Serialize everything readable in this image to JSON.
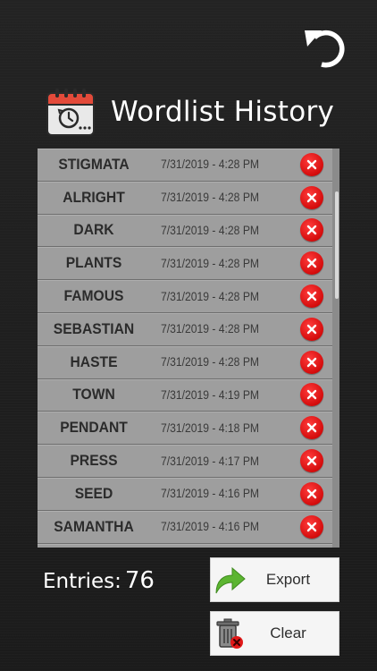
{
  "header": {
    "title": "Wordlist History"
  },
  "history": {
    "rows": [
      {
        "word": "STIGMATA",
        "date": "7/31/2019 - 4:28 PM"
      },
      {
        "word": "ALRIGHT",
        "date": "7/31/2019 - 4:28 PM"
      },
      {
        "word": "DARK",
        "date": "7/31/2019 - 4:28 PM"
      },
      {
        "word": "PLANTS",
        "date": "7/31/2019 - 4:28 PM"
      },
      {
        "word": "FAMOUS",
        "date": "7/31/2019 - 4:28 PM"
      },
      {
        "word": "SEBASTIAN",
        "date": "7/31/2019 - 4:28 PM"
      },
      {
        "word": "HASTE",
        "date": "7/31/2019 - 4:28 PM"
      },
      {
        "word": "TOWN",
        "date": "7/31/2019 - 4:19 PM"
      },
      {
        "word": "PENDANT",
        "date": "7/31/2019 - 4:18 PM"
      },
      {
        "word": "PRESS",
        "date": "7/31/2019 - 4:17 PM"
      },
      {
        "word": "SEED",
        "date": "7/31/2019 - 4:16 PM"
      },
      {
        "word": "SAMANTHA",
        "date": "7/31/2019 - 4:16 PM"
      }
    ]
  },
  "footer": {
    "entries_label": "Entries:",
    "entries_count": "76",
    "export_label": "Export",
    "clear_label": "Clear"
  },
  "icons": {
    "back": "undo-arrow-icon",
    "header": "calendar-clock-icon",
    "delete": "delete-x-icon",
    "export": "green-arrow-icon",
    "clear": "trash-can-icon"
  },
  "colors": {
    "background": "#1e1e1e",
    "row": "#9e9e9e",
    "delete_red": "#e01818",
    "export_green": "#5cb531"
  }
}
